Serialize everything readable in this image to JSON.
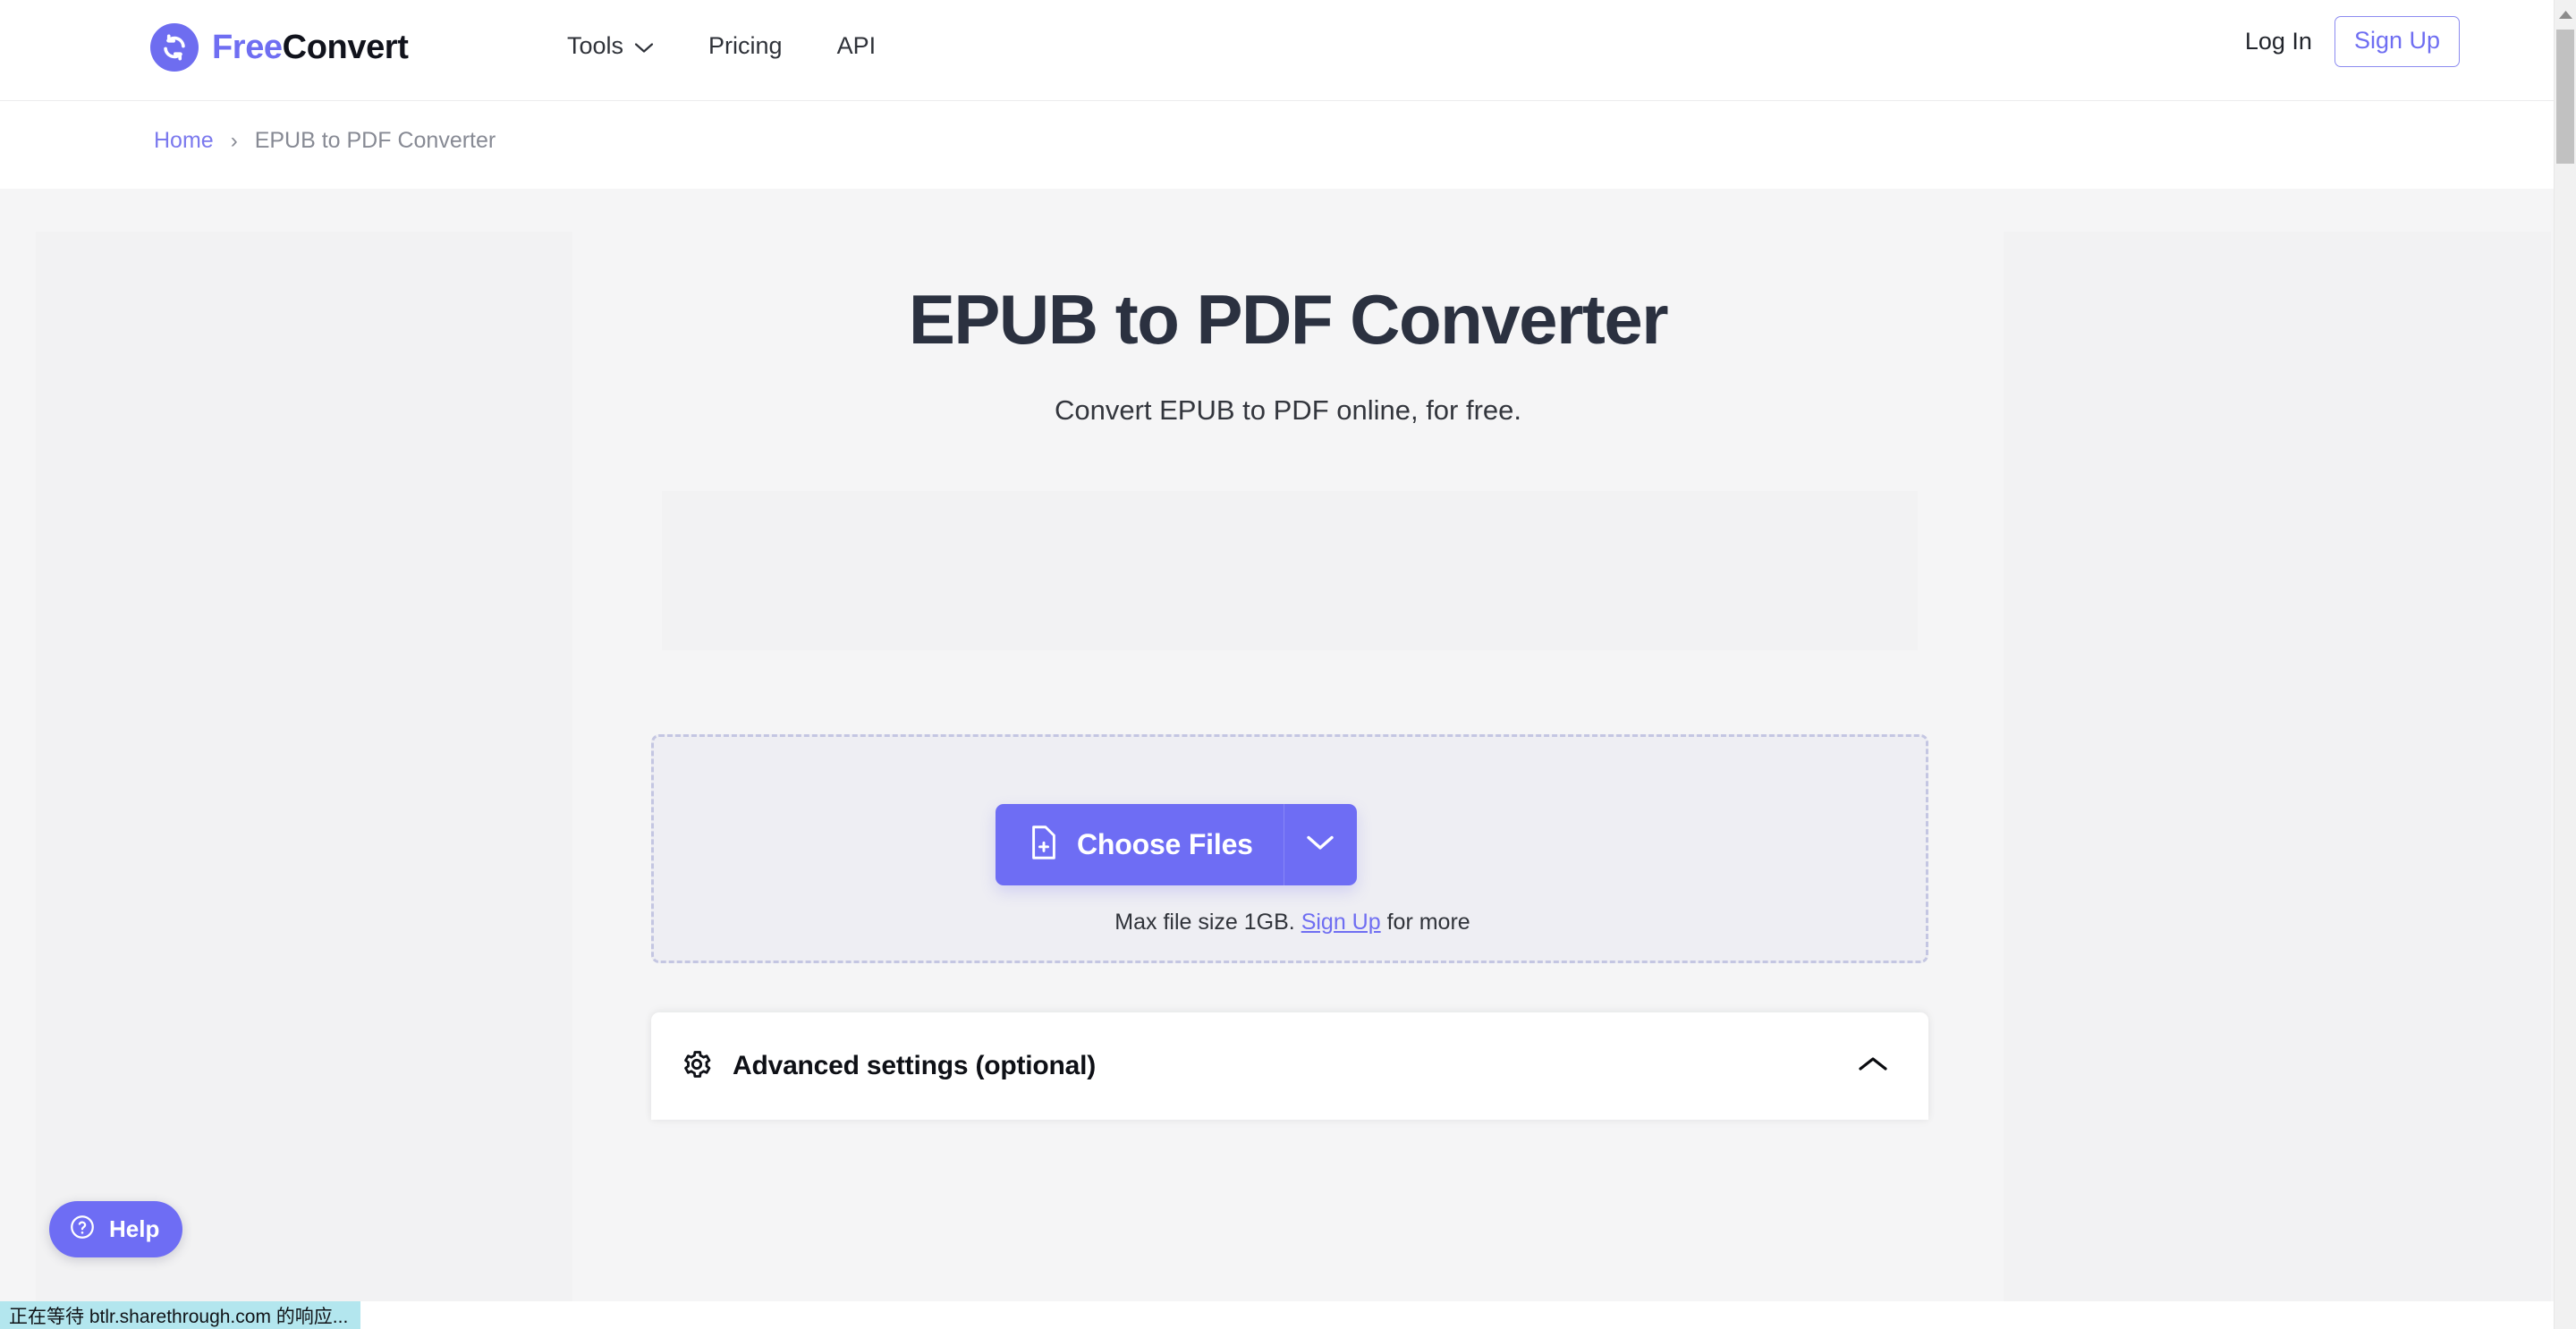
{
  "header": {
    "brand": {
      "first": "Free",
      "second": "Convert",
      "icon": "convert-arrows-icon"
    },
    "nav": [
      {
        "label": "Tools",
        "has_caret": true
      },
      {
        "label": "Pricing",
        "has_caret": false
      },
      {
        "label": "API",
        "has_caret": false
      }
    ],
    "login_label": "Log In",
    "signup_label": "Sign Up"
  },
  "breadcrumb": {
    "home_label": "Home",
    "separator": "›",
    "current_label": "EPUB to PDF Converter"
  },
  "main": {
    "title": "EPUB to PDF Converter",
    "subtitle": "Convert EPUB to PDF online, for free.",
    "choose_files_label": "Choose Files",
    "max_size_prefix": "Max file size 1GB.",
    "max_size_link": "Sign Up",
    "max_size_suffix": "for more",
    "advanced_label": "Advanced settings (optional)"
  },
  "help": {
    "label": "Help",
    "icon": "question-circle-icon"
  },
  "status": {
    "text": "正在等待 btlr.sharethrough.com 的响应..."
  },
  "colors": {
    "brand_purple": "#6e6df4",
    "brand_purple_light": "#8c8bf0",
    "title_navy": "#2b3140",
    "dropzone_fill": "#eeeef3",
    "dropzone_border": "#c4c6e2",
    "page_bg": "#f5f5f6",
    "ad_fill": "#f2f2f3",
    "status_bg": "#b3e6ee",
    "scrollbar_thumb": "#c1c1c1"
  }
}
